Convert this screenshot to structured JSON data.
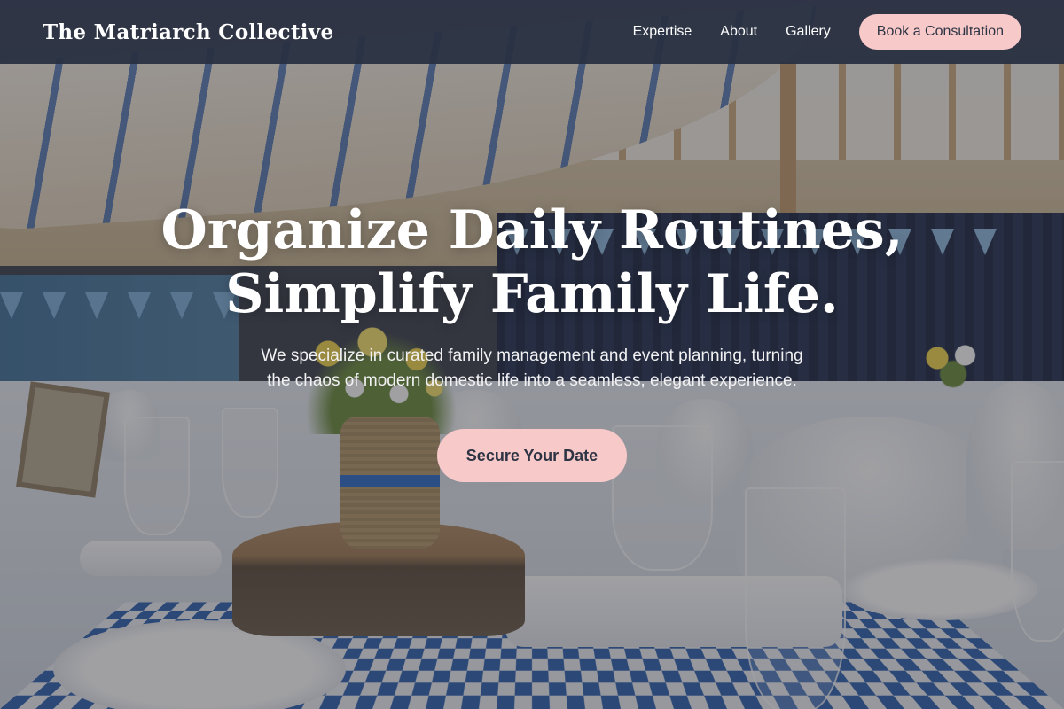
{
  "brand": {
    "name": "The Matriarch Collective"
  },
  "nav": {
    "links": [
      "Expertise",
      "About",
      "Gallery"
    ],
    "cta_label": "Book a Consultation"
  },
  "hero": {
    "title_line1": "Organize Daily Routines,",
    "title_line2": "Simplify Family Life.",
    "subtitle": "We specialize in curated family management and event planning, turning the chaos of modern domestic life into a seamless, elegant experience.",
    "cta_label": "Secure Your Date"
  },
  "colors": {
    "navbar_bg": "#283042",
    "accent_pink": "#f7c9c9",
    "cta_text": "#2d3443",
    "hero_text": "#ffffff"
  }
}
